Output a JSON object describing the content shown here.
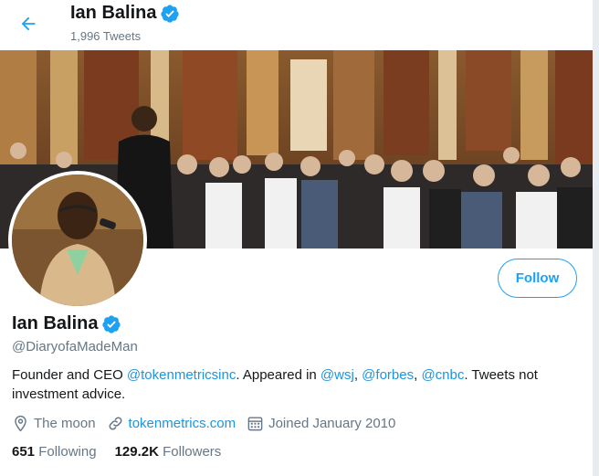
{
  "header": {
    "name": "Ian Balina",
    "tweet_count": "1,996 Tweets"
  },
  "profile": {
    "name": "Ian Balina",
    "handle": "@DiaryofaMadeMan",
    "follow_label": "Follow",
    "bio": {
      "part1": "Founder and CEO ",
      "mention1": "@tokenmetricsinc",
      "part2": ". Appeared in ",
      "mention2": "@wsj",
      "part3": ", ",
      "mention3": "@forbes",
      "part4": ", ",
      "mention4": "@cnbc",
      "part5": ". Tweets not investment advice."
    },
    "location": "The moon",
    "website": "tokenmetrics.com",
    "joined": "Joined January 2010",
    "following_count": "651",
    "following_label": "Following",
    "followers_count": "129.2K",
    "followers_label": "Followers"
  },
  "colors": {
    "accent": "#1da1f2",
    "link": "#1b95e0",
    "muted": "#657786"
  },
  "icons": {
    "back": "arrow-left-icon",
    "verified": "verified-badge-icon",
    "location": "location-pin-icon",
    "link": "link-icon",
    "calendar": "calendar-icon"
  }
}
